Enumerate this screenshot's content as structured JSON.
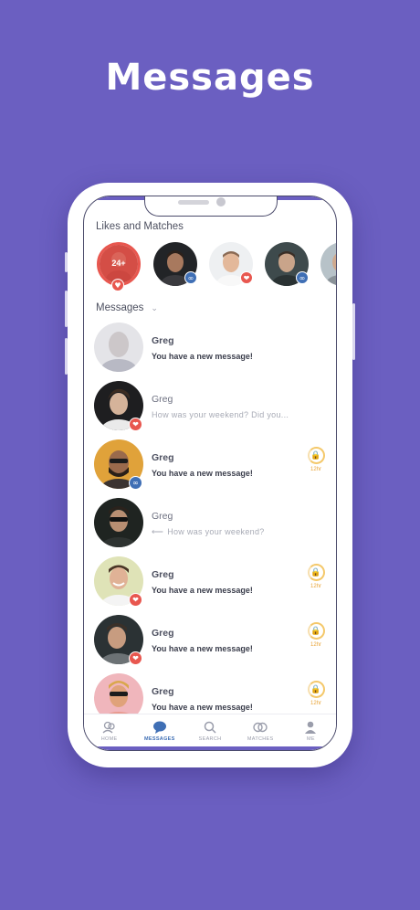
{
  "page": {
    "headline": "Messages"
  },
  "likes_section": {
    "title": "Likes and Matches",
    "first_count": "24+",
    "avatars": [
      {
        "name": "likes-count-avatar",
        "badge": "heart"
      },
      {
        "name": "match-avatar-1",
        "badge": "match"
      },
      {
        "name": "match-avatar-2",
        "badge": "like"
      },
      {
        "name": "match-avatar-3",
        "badge": "match"
      },
      {
        "name": "match-avatar-4",
        "badge": "none"
      }
    ]
  },
  "messages_section": {
    "title": "Messages",
    "items": [
      {
        "name": "Greg",
        "text": "You have a new message!",
        "unread": true,
        "reply": false,
        "badge": "none",
        "locked": false
      },
      {
        "name": "Greg",
        "text": "How was your weekend? Did you...",
        "unread": false,
        "reply": false,
        "badge": "like",
        "locked": false
      },
      {
        "name": "Greg",
        "text": "You have a new message!",
        "unread": true,
        "reply": false,
        "badge": "match",
        "locked": true,
        "lock_time": "12hr"
      },
      {
        "name": "Greg",
        "text": "How was your weekend?",
        "unread": false,
        "reply": true,
        "badge": "none",
        "locked": false
      },
      {
        "name": "Greg",
        "text": "You have a new message!",
        "unread": true,
        "reply": false,
        "badge": "like",
        "locked": true,
        "lock_time": "12hr"
      },
      {
        "name": "Greg",
        "text": "You have a new message!",
        "unread": true,
        "reply": false,
        "badge": "like",
        "locked": true,
        "lock_time": "12hr"
      },
      {
        "name": "Greg",
        "text": "You have a new message!",
        "unread": true,
        "reply": false,
        "badge": "none",
        "locked": true,
        "lock_time": "12hr"
      }
    ]
  },
  "tabbar": {
    "tabs": [
      {
        "label": "HOME",
        "icon": "home-icon",
        "active": false
      },
      {
        "label": "MESSAGES",
        "icon": "chat-icon",
        "active": true
      },
      {
        "label": "SEARCH",
        "icon": "search-icon",
        "active": false
      },
      {
        "label": "MATCHES",
        "icon": "matches-icon",
        "active": false
      },
      {
        "label": "ME",
        "icon": "person-icon",
        "active": false
      }
    ]
  },
  "colors": {
    "background": "#6b5fc1",
    "like_red": "#e8574f",
    "match_blue": "#3f6fb5",
    "lock_orange": "#e9a53a"
  }
}
